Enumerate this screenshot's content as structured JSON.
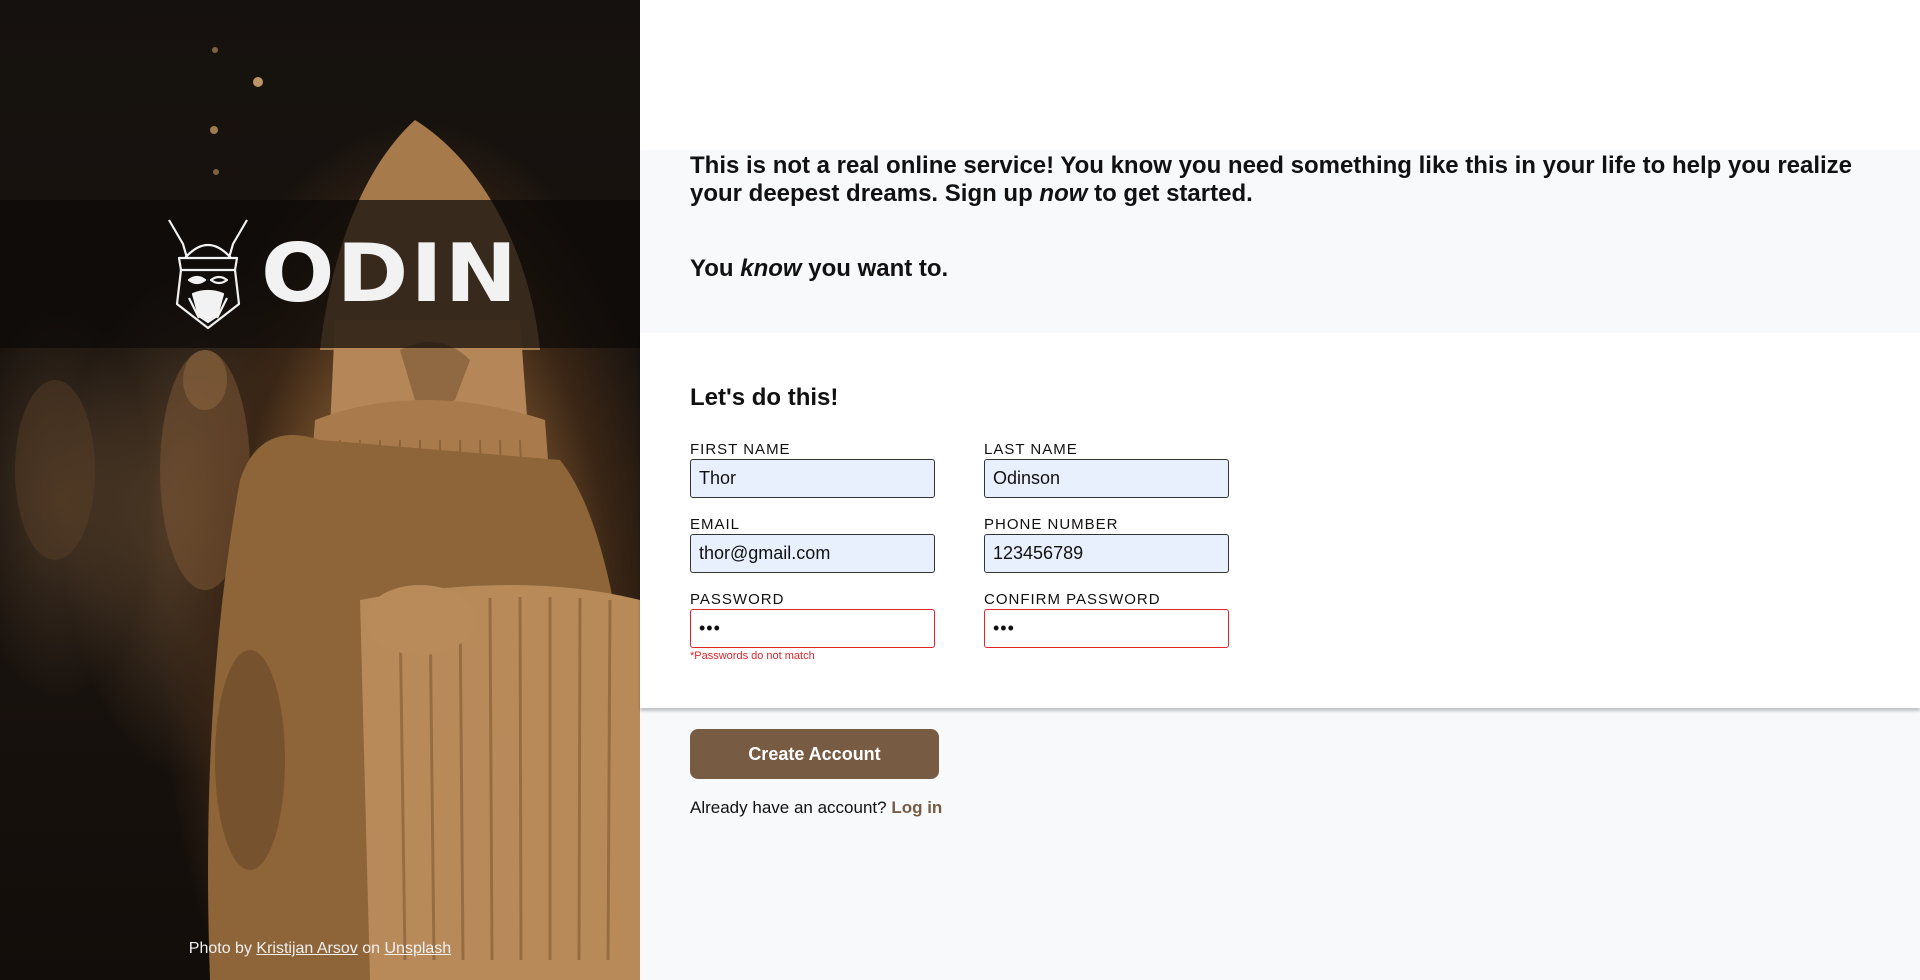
{
  "brand": {
    "name": "ODIN",
    "logo_icon": "viking-helmet-icon"
  },
  "credit": {
    "prefix": "Photo by",
    "author": "Kristijan Arsov",
    "middle": "on",
    "site": "Unsplash"
  },
  "intro": {
    "line1_part1": "This is not a real online service! You know you need something like this in your life to help you realize your deepest dreams. Sign up",
    "line1_em": "now",
    "line1_part2": "to get started.",
    "tagline_part1": "You",
    "tagline_em": "know",
    "tagline_part2": "you want to."
  },
  "form": {
    "title": "Let's do this!",
    "first_name": {
      "label": "FIRST NAME",
      "value": "Thor"
    },
    "last_name": {
      "label": "LAST NAME",
      "value": "Odinson"
    },
    "email": {
      "label": "EMAIL",
      "value": "thor@gmail.com"
    },
    "phone": {
      "label": "PHONE NUMBER",
      "value": "123456789"
    },
    "password": {
      "label": "PASSWORD",
      "value": "•••"
    },
    "confirm_password": {
      "label": "CONFIRM PASSWORD",
      "value": "•••"
    },
    "error_message": "*Passwords do not match",
    "submit_label": "Create Account",
    "login_prompt": "Already have an account?",
    "login_link": "Log in"
  },
  "colors": {
    "accent": "#775c43",
    "error": "#e0242b",
    "autofill_bg": "#e8f0fe"
  }
}
